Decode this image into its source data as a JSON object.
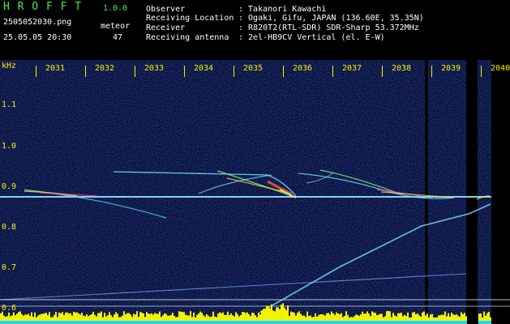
{
  "app": {
    "logo": "H R O F F T",
    "version": "1.0.0"
  },
  "file": {
    "name": "2505052030.png",
    "datetime": "25.05.05 20:30"
  },
  "count": {
    "label": "meteor",
    "value": "47"
  },
  "info": {
    "observer_label": "Observer",
    "observer_value": ": Takanori Kawachi",
    "location_label": "Receiving Location",
    "location_value": ": Ogaki, Gifu, JAPAN (136.60E, 35.35N)",
    "receiver_label": "Receiver",
    "receiver_value": ": R820T2(RTL-SDR) SDR-Sharp 53.372MHz",
    "antenna_label": "Receiving antenna",
    "antenna_value": ": 2el-HB9CV Vertical (el. E-W)"
  },
  "axis": {
    "unit": "kHz",
    "time_labels": [
      "2031",
      "2032",
      "2033",
      "2034",
      "2035",
      "2036",
      "2037",
      "2038",
      "2039",
      "2040"
    ],
    "freq_labels": [
      "1.1",
      "1.0",
      "0.9",
      "0.8",
      "0.7",
      "0.6"
    ]
  },
  "colors": {
    "green": "#3cf04a",
    "yellow": "#f2f200",
    "white": "#ffffff",
    "background": "#04082a"
  }
}
